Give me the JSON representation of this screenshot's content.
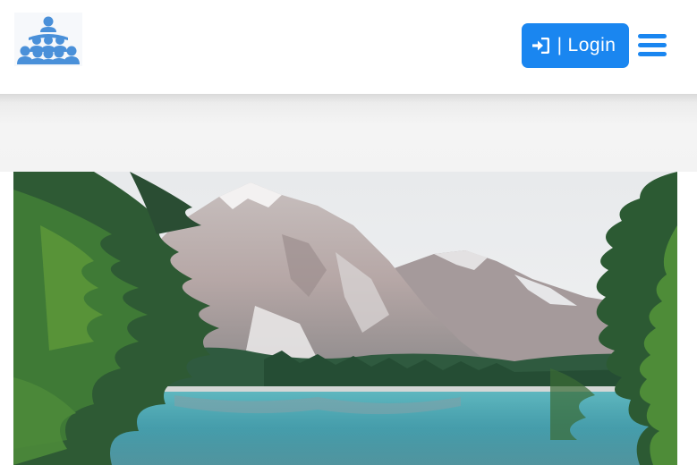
{
  "header": {
    "logo_icon": "group-people-icon",
    "login_button": {
      "icon": "sign-in-icon",
      "separator": "|",
      "label": "Login"
    },
    "menu_icon": "hamburger-menu-icon"
  },
  "hero": {
    "image": "mountain-lake-landscape"
  },
  "colors": {
    "accent": "#1a86f0",
    "logo": "#4a90d9",
    "background": "#ffffff"
  }
}
